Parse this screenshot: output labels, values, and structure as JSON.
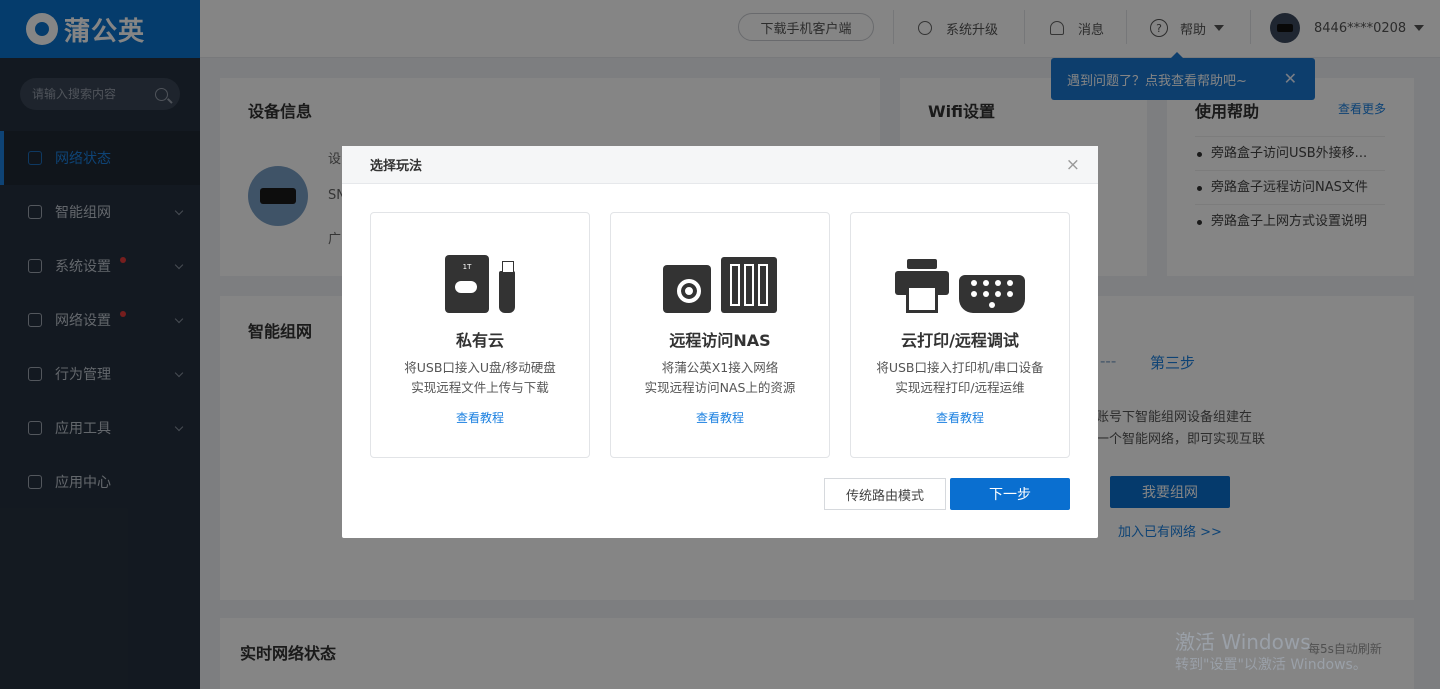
{
  "brand": {
    "name": "蒲公英"
  },
  "sidebar": {
    "search_placeholder": "请输入搜索内容",
    "items": [
      {
        "label": "网络状态"
      },
      {
        "label": "智能组网"
      },
      {
        "label": "系统设置"
      },
      {
        "label": "网络设置"
      },
      {
        "label": "行为管理"
      },
      {
        "label": "应用工具"
      },
      {
        "label": "应用中心"
      }
    ]
  },
  "header": {
    "download": "下载手机客户端",
    "upgrade": "系统升级",
    "messages": "消息",
    "help": "帮助",
    "account": "8446****0208"
  },
  "tooltip": {
    "text": "遇到问题了？点我查看帮助吧~"
  },
  "device": {
    "title": "设备信息",
    "label1": "设",
    "label2": "SN",
    "label3": "广"
  },
  "wifi": {
    "title": "Wifi设置"
  },
  "usage_help": {
    "title": "使用帮助",
    "more": "查看更多",
    "items": [
      "旁路盒子访问USB外接移...",
      "旁路盒子远程访问NAS文件",
      "旁路盒子上网方式设置说明"
    ]
  },
  "mesh": {
    "title": "智能组网",
    "dashes": "---",
    "step3": "第三步",
    "line1": "账号下智能组网设备组建在",
    "line2": "一个智能网络，即可实现互联",
    "join_button": "我要组网",
    "join_link": "加入已有网络 >>"
  },
  "realtime": {
    "title": "实时网络状态",
    "refresh": "每5s自动刷新"
  },
  "watermark": {
    "line1": "激活 Windows",
    "line2": "转到\"设置\"以激活 Windows。"
  },
  "modal": {
    "title": "选择玩法",
    "close": "×",
    "options": [
      {
        "title": "私有云",
        "line1": "将USB口接入U盘/移动硬盘",
        "line2": "实现远程文件上传与下载",
        "link": "查看教程",
        "badge": "1T"
      },
      {
        "title": "远程访问NAS",
        "line1": "将蒲公英X1接入网络",
        "line2": "实现远程访问NAS上的资源",
        "link": "查看教程"
      },
      {
        "title": "云打印/远程调试",
        "line1": "将USB口接入打印机/串口设备",
        "line2": "实现远程打印/远程运维",
        "link": "查看教程"
      }
    ],
    "btn_traditional": "传统路由模式",
    "btn_next": "下一步"
  }
}
